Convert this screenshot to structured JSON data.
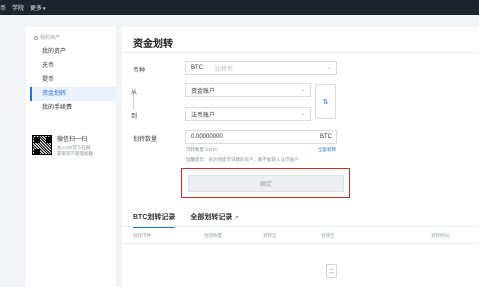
{
  "topnav": {
    "items": [
      {
        "label": "币"
      },
      {
        "label": "学院"
      },
      {
        "label": "更多"
      }
    ]
  },
  "sidebar": {
    "section_title": "我的资产",
    "items": [
      {
        "label": "我的资产"
      },
      {
        "label": "充币"
      },
      {
        "label": "提币"
      },
      {
        "label": "资金划转",
        "active": true
      },
      {
        "label": "我的手续费"
      }
    ],
    "qr": {
      "title": "微信扫一扫",
      "line1": "加入OK官方社群",
      "line2": "获取资产管理秘籍"
    }
  },
  "main": {
    "title": "资金划转",
    "currency_label": "币种",
    "currency_value": "BTC",
    "currency_placeholder": "比特币",
    "from_label": "从",
    "from_value": "资金账户",
    "to_label": "到",
    "to_value": "法币账户",
    "amount_label": "划转数量",
    "amount_value": "0.00000000",
    "amount_unit": "BTC",
    "available_text": "可转数量 0 BTC",
    "transfer_all": "全部划转",
    "tip": "温馨提示：未达到提币日额的资产，暂不能转入法币账户",
    "confirm_label": "确定"
  },
  "records": {
    "tabs": [
      {
        "label": "BTC划转记录",
        "active": true
      },
      {
        "label": "全部划转记录"
      }
    ],
    "columns": [
      "划转币种",
      "划转数量",
      "划转自",
      "划转至",
      "划转时间"
    ]
  },
  "colors": {
    "accent": "#2b6fd9",
    "highlight_border": "#e0251f",
    "nav_bg": "#1c2431"
  }
}
